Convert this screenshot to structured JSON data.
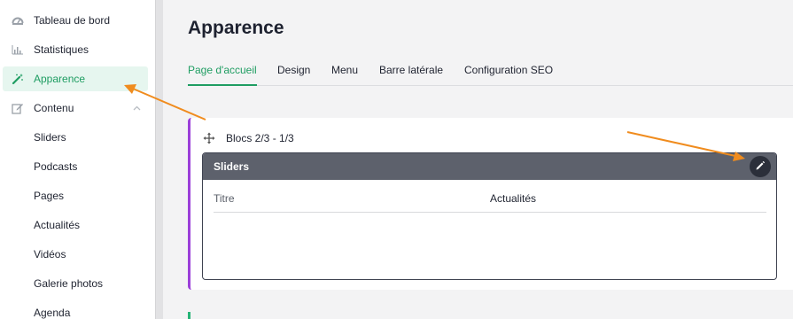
{
  "sidebar": {
    "items": [
      {
        "label": "Tableau de bord",
        "icon": "dashboard-gauge-icon"
      },
      {
        "label": "Statistiques",
        "icon": "bar-chart-icon"
      },
      {
        "label": "Apparence",
        "icon": "magic-wand-icon",
        "active": true
      },
      {
        "label": "Contenu",
        "icon": "edit-square-icon",
        "expanded": true
      }
    ],
    "subitems": [
      "Sliders",
      "Podcasts",
      "Pages",
      "Actualités",
      "Vidéos",
      "Galerie photos",
      "Agenda"
    ]
  },
  "page": {
    "title": "Apparence",
    "tabs": [
      "Page d'accueil",
      "Design",
      "Menu",
      "Barre latérale",
      "Configuration SEO"
    ],
    "active_tab": "Page d'accueil"
  },
  "card": {
    "header": "Blocs 2/3 - 1/3",
    "block": {
      "title": "Sliders",
      "field_label": "Titre",
      "field_value": "Actualités"
    }
  },
  "colors": {
    "accent": "#1f9d62",
    "card_border": "#9b3fd9",
    "block_header": "#5d616c",
    "annotation_arrow": "#f08c1e"
  }
}
